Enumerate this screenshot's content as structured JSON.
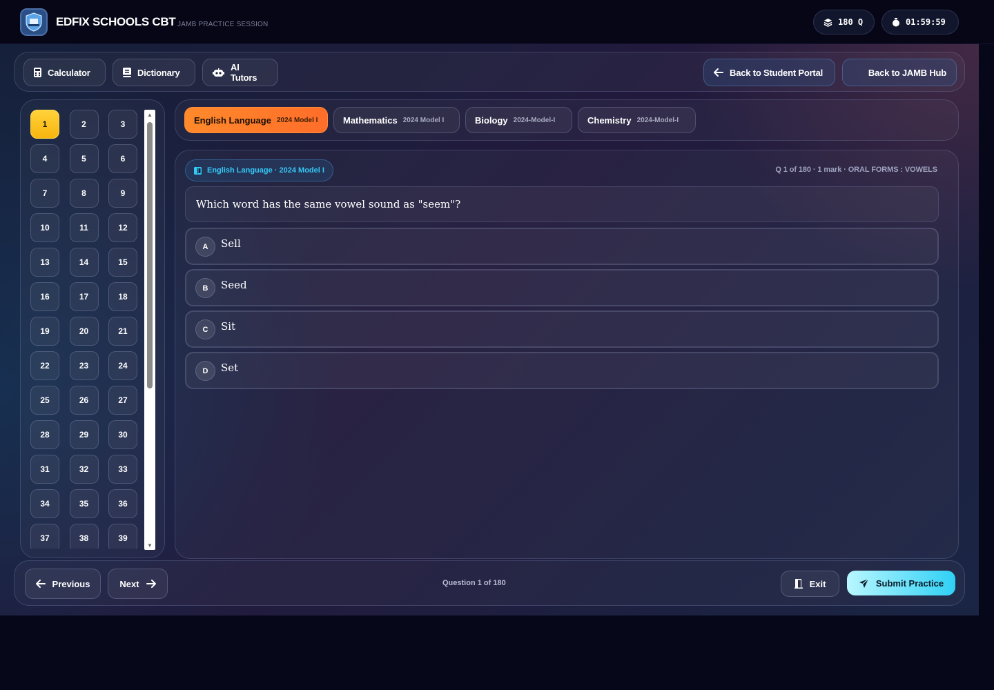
{
  "header": {
    "app_title": "EDFIX SCHOOLS CBT",
    "subtitle": "JAMB PRACTICE SESSION",
    "question_count": "180 Q",
    "timer": "01:59:59"
  },
  "toolbar": {
    "calculator": "Calculator",
    "dictionary": "Dictionary",
    "ai_tutors": "AI Tutors",
    "back_portal": "Back to Student Portal",
    "back_hub": "Back to JAMB Hub"
  },
  "question_nav": {
    "current": 1,
    "numbers": [
      "1",
      "2",
      "3",
      "4",
      "5",
      "6",
      "7",
      "8",
      "9",
      "10",
      "11",
      "12",
      "13",
      "14",
      "15",
      "16",
      "17",
      "18",
      "19",
      "20",
      "21",
      "22",
      "23",
      "24",
      "25",
      "26",
      "27",
      "28",
      "29",
      "30",
      "31",
      "32",
      "33",
      "34",
      "35",
      "36",
      "37",
      "38",
      "39"
    ]
  },
  "subjects": [
    {
      "name": "English Language",
      "model": "2024 Model I",
      "active": true
    },
    {
      "name": "Mathematics",
      "model": "2024 Model I",
      "active": false
    },
    {
      "name": "Biology",
      "model": "2024-Model-I",
      "active": false
    },
    {
      "name": "Chemistry",
      "model": "2024-Model-I",
      "active": false
    }
  ],
  "question": {
    "tag": "English Language · 2024 Model I",
    "meta": "Q 1 of 180 · 1 mark · ORAL FORMS : VOWELS",
    "text": "Which word has the same vowel sound as \"seem\"?",
    "options": [
      {
        "letter": "A",
        "text": "Sell"
      },
      {
        "letter": "B",
        "text": "Seed"
      },
      {
        "letter": "C",
        "text": "Sit"
      },
      {
        "letter": "D",
        "text": "Set"
      }
    ]
  },
  "footer": {
    "previous": "Previous",
    "next": "Next",
    "counter": "Question 1 of 180",
    "exit": "Exit",
    "submit": "Submit Practice"
  },
  "colors": {
    "accent_orange": "#ff7a2a",
    "accent_yellow": "#fcc521",
    "accent_cyan": "#36c8f5"
  }
}
